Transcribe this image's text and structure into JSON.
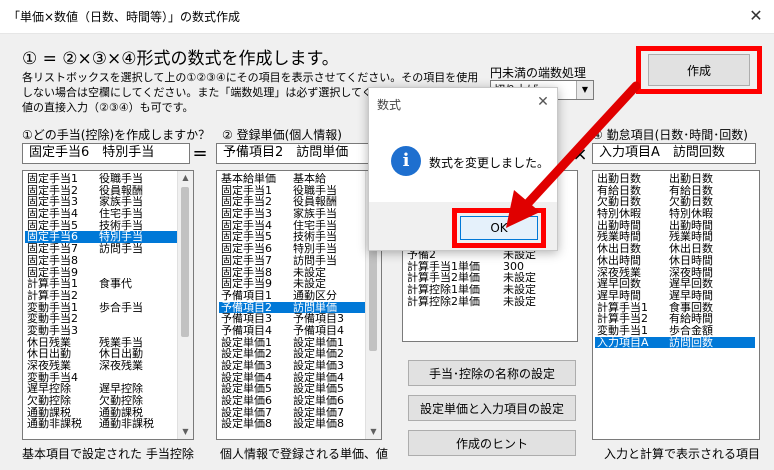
{
  "window": {
    "title": "「単価×数値（日数、時間等）」の数式作成",
    "close_glyph": "✕"
  },
  "heading": "① = ②×③×④形式の数式を作成します。",
  "description": "各リストボックスを選択して上の①②③④にその項目を表示させてください。その項目を使用\nしない場合は空欄にしてください。また「端数処理」は必ず選択してください\n値の直接入力（②③④）も可です。",
  "create_button": "作成",
  "rounding": {
    "label": "円未満の端数処理",
    "value": "切り上げ"
  },
  "columns": {
    "c1": {
      "label": "①どの手当(控除)を作成しますか？",
      "value": "固定手当6　特別手当",
      "footer": "基本項目で設定された 手当控除",
      "items": [
        [
          "固定手当1",
          "役職手当"
        ],
        [
          "固定手当2",
          "役員報酬"
        ],
        [
          "固定手当3",
          "家族手当"
        ],
        [
          "固定手当4",
          "住宅手当"
        ],
        [
          "固定手当5",
          "技術手当"
        ],
        [
          "固定手当6",
          "特別手当"
        ],
        [
          "固定手当7",
          "訪問手当"
        ],
        [
          "固定手当8",
          ""
        ],
        [
          "固定手当9",
          ""
        ],
        [
          "計算手当1",
          "食事代"
        ],
        [
          "計算手当2",
          ""
        ],
        [
          "変動手当1",
          "歩合手当"
        ],
        [
          "変動手当2",
          ""
        ],
        [
          "変動手当3",
          ""
        ],
        [
          "休日残業",
          "残業手当"
        ],
        [
          "休日出勤",
          "休日出勤"
        ],
        [
          "深夜残業",
          "深夜残業"
        ],
        [
          "変動手当4",
          ""
        ],
        [
          "遅早控除",
          "遅早控除"
        ],
        [
          "欠勤控除",
          "欠勤控除"
        ],
        [
          "通勤課税",
          "通勤課税"
        ],
        [
          "通勤非課税",
          "通勤非課税"
        ]
      ],
      "selected": 5
    },
    "c2": {
      "label": "②  登録単価(個人情報)",
      "value": "予備項目2　訪問単価",
      "footer": "個人情報で登録される単価、値",
      "items": [
        [
          "基本給単価",
          "基本給"
        ],
        [
          "固定手当1",
          "役職手当"
        ],
        [
          "固定手当2",
          "役員報酬"
        ],
        [
          "固定手当3",
          "家族手当"
        ],
        [
          "固定手当4",
          "住宅手当"
        ],
        [
          "固定手当5",
          "技術手当"
        ],
        [
          "固定手当6",
          "特別手当"
        ],
        [
          "固定手当7",
          "訪問手当"
        ],
        [
          "固定手当8",
          "未設定"
        ],
        [
          "固定手当9",
          "未設定"
        ],
        [
          "予備項目1",
          "通勤区分"
        ],
        [
          "予備項目2",
          "訪問単価"
        ],
        [
          "予備項目3",
          "予備項目3"
        ],
        [
          "予備項目4",
          "予備項目4"
        ],
        [
          "設定単価1",
          "設定単価1"
        ],
        [
          "設定単価2",
          "設定単価2"
        ],
        [
          "設定単価3",
          "設定単価3"
        ],
        [
          "設定単価4",
          "設定単価4"
        ],
        [
          "設定単価5",
          "設定単価5"
        ],
        [
          "設定単価6",
          "設定単価6"
        ],
        [
          "設定単価7",
          "設定単価7"
        ],
        [
          "設定単価8",
          "設定単価8"
        ]
      ],
      "selected": 11
    },
    "c3": {
      "items": [
        [
          "予備2",
          "未設定"
        ],
        [
          "計算手当1単価",
          "300"
        ],
        [
          "計算手当2単価",
          "未設定"
        ],
        [
          "計算控除1単価",
          "未設定"
        ],
        [
          "計算控除2単価",
          "未設定"
        ]
      ]
    },
    "c4": {
      "label": "④  勤怠項目(日数･時間･回数)",
      "value": "入力項目A　訪問回数",
      "footer": "入力と計算で表示される項目",
      "items": [
        [
          "出勤日数",
          "出勤日数"
        ],
        [
          "有給日数",
          "有給日数"
        ],
        [
          "欠勤日数",
          "欠勤日数"
        ],
        [
          "特別休暇",
          "特別休暇"
        ],
        [
          "出勤時間",
          "出勤時間"
        ],
        [
          "残業時間",
          "残業時間"
        ],
        [
          "休出日数",
          "休出日数"
        ],
        [
          "休出時間",
          "休日時間"
        ],
        [
          "深夜残業",
          "深夜時間"
        ],
        [
          "遅早回数",
          "遅早回数"
        ],
        [
          "遅早時間",
          "遅早時間"
        ],
        [
          "計算手当1",
          "食事回数"
        ],
        [
          "計算手当2",
          "有給時間"
        ],
        [
          "変動手当1",
          "歩合金額"
        ],
        [
          "入力項目A",
          "訪問回数"
        ]
      ],
      "selected": 14
    }
  },
  "operators": {
    "eq": "=",
    "x3": "×"
  },
  "side_buttons": {
    "names": "手当･控除の名称の設定",
    "unit_input": "設定単価と入力項目の設定",
    "hint": "作成のヒント"
  },
  "dialog": {
    "title": "数式",
    "close_glyph": "✕",
    "icon_glyph": "i",
    "message": "数式を変更しました。",
    "ok": "OK"
  },
  "colors": {
    "highlight": "#ff0000",
    "selection": "#0078d7",
    "info": "#1e6fcf"
  }
}
